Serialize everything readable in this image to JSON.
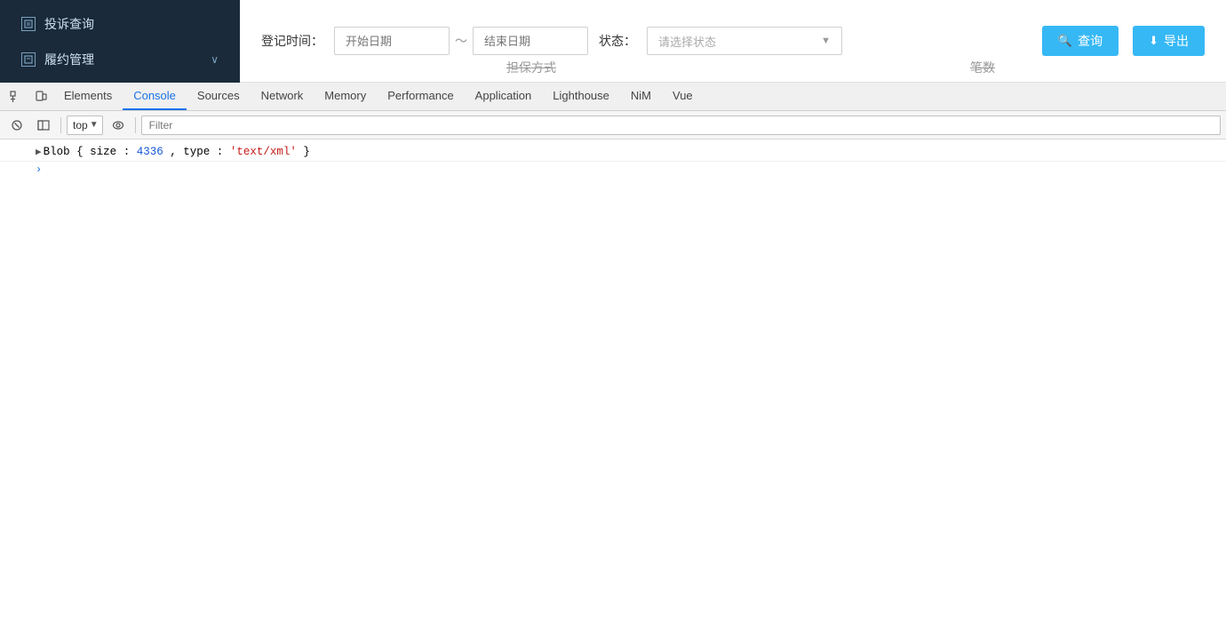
{
  "sidebar": {
    "items": [
      {
        "label": "投诉查询",
        "icon": "document-icon",
        "has_chevron": false
      },
      {
        "label": "履约管理",
        "icon": "document-icon",
        "has_chevron": true
      }
    ]
  },
  "topbar": {
    "login_time_label": "登记时间：",
    "date_start_placeholder": "开始日期",
    "date_separator": "～",
    "date_end_placeholder": "结束日期",
    "status_label": "状态：",
    "status_placeholder": "请选择状态",
    "query_btn": "查询",
    "export_btn": "导出",
    "strikethrough1": "担保方式",
    "strikethrough2": "笔数"
  },
  "devtools": {
    "tabs": [
      {
        "label": "Elements",
        "active": false
      },
      {
        "label": "Console",
        "active": true
      },
      {
        "label": "Sources",
        "active": false
      },
      {
        "label": "Network",
        "active": false
      },
      {
        "label": "Memory",
        "active": false
      },
      {
        "label": "Performance",
        "active": false
      },
      {
        "label": "Application",
        "active": false
      },
      {
        "label": "Lighthouse",
        "active": false
      },
      {
        "label": "NiM",
        "active": false
      },
      {
        "label": "Vue",
        "active": false
      }
    ],
    "console": {
      "context": "top",
      "filter_placeholder": "Filter",
      "blob_line": {
        "expand_symbol": "▶",
        "key": "Blob",
        "size_label": "size",
        "size_value": "4336",
        "type_label": "type",
        "type_value": "'text/xml'"
      }
    }
  }
}
